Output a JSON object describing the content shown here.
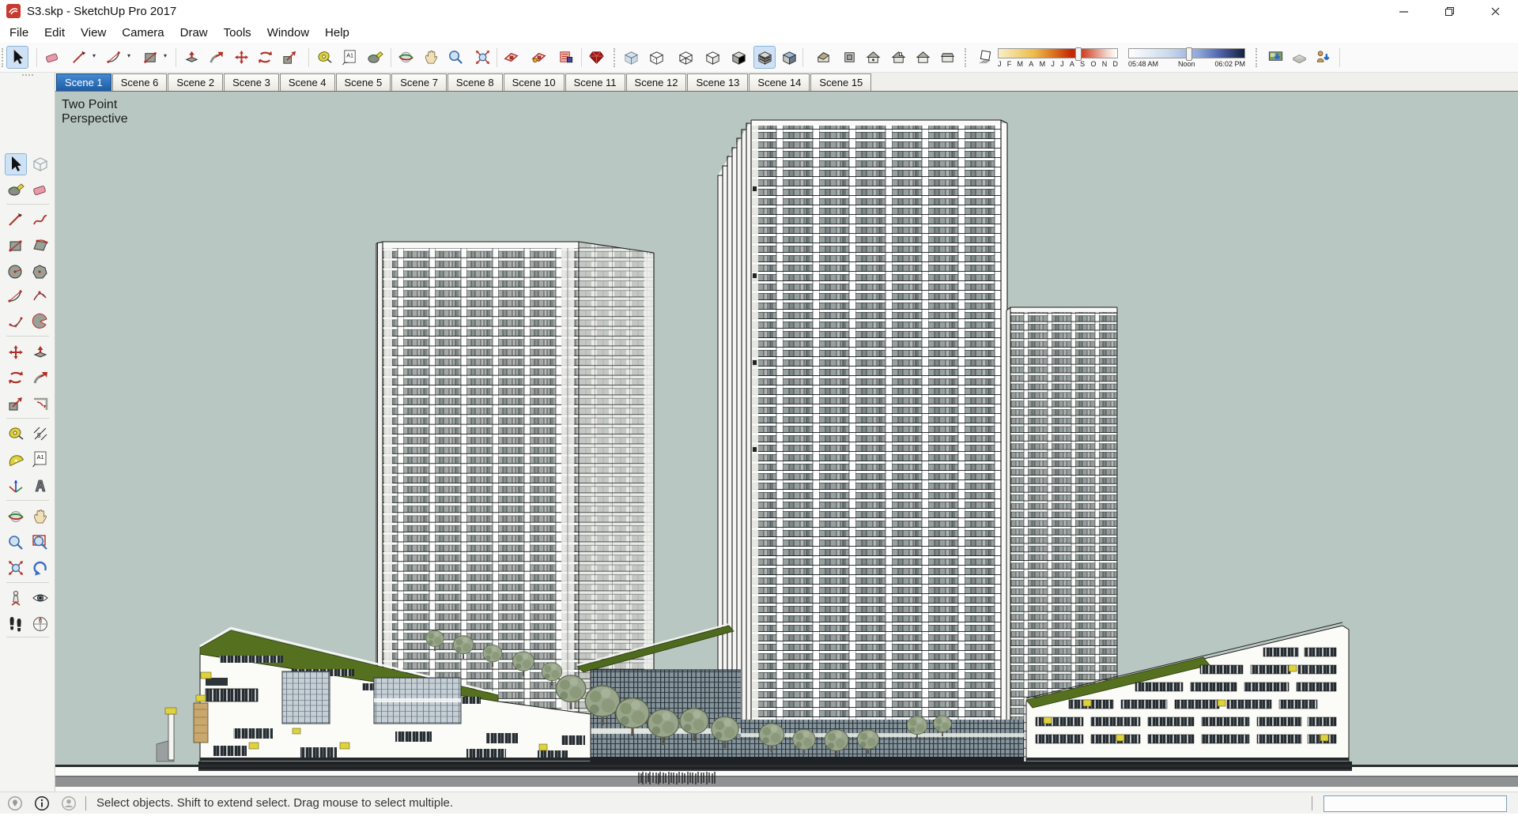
{
  "window": {
    "title": "S3.skp - SketchUp Pro 2017",
    "controls": [
      "minimize",
      "restore",
      "close"
    ]
  },
  "menu": {
    "items": [
      "File",
      "Edit",
      "View",
      "Camera",
      "Draw",
      "Tools",
      "Window",
      "Help"
    ]
  },
  "toolbar": {
    "items": [
      {
        "kind": "grip"
      },
      {
        "kind": "icon",
        "name": "select-icon",
        "active": true
      },
      {
        "kind": "sep"
      },
      {
        "kind": "icon",
        "name": "eraser-icon"
      },
      {
        "kind": "icon",
        "name": "line-icon"
      },
      {
        "kind": "dropdown"
      },
      {
        "kind": "icon",
        "name": "arc-icon"
      },
      {
        "kind": "dropdown"
      },
      {
        "kind": "icon",
        "name": "rectangle-icon"
      },
      {
        "kind": "dropdown"
      },
      {
        "kind": "sep"
      },
      {
        "kind": "icon",
        "name": "push-pull-icon"
      },
      {
        "kind": "icon",
        "name": "follow-me-icon"
      },
      {
        "kind": "icon",
        "name": "move-icon"
      },
      {
        "kind": "icon",
        "name": "rotate-icon"
      },
      {
        "kind": "icon",
        "name": "scale-icon"
      },
      {
        "kind": "sep"
      },
      {
        "kind": "icon",
        "name": "tape-measure-icon"
      },
      {
        "kind": "icon",
        "name": "text-icon"
      },
      {
        "kind": "icon",
        "name": "paint-bucket-icon"
      },
      {
        "kind": "sep"
      },
      {
        "kind": "icon",
        "name": "orbit-icon"
      },
      {
        "kind": "icon",
        "name": "pan-icon"
      },
      {
        "kind": "icon",
        "name": "zoom-icon"
      },
      {
        "kind": "icon",
        "name": "zoom-extents-icon"
      },
      {
        "kind": "sep"
      },
      {
        "kind": "icon",
        "name": "section-cut-icon"
      },
      {
        "kind": "icon",
        "name": "section-display-icon"
      },
      {
        "kind": "icon",
        "name": "section-fill-icon"
      },
      {
        "kind": "sep"
      },
      {
        "kind": "icon",
        "name": "ruby-console-icon"
      },
      {
        "kind": "grip"
      },
      {
        "kind": "icon",
        "name": "xray-icon"
      },
      {
        "kind": "icon",
        "name": "back-edges-icon"
      },
      {
        "kind": "icon",
        "name": "wireframe-icon"
      },
      {
        "kind": "icon",
        "name": "hidden-line-icon"
      },
      {
        "kind": "icon",
        "name": "shaded-icon"
      },
      {
        "kind": "icon",
        "name": "shaded-textures-icon",
        "active": true
      },
      {
        "kind": "icon",
        "name": "monochrome-icon"
      },
      {
        "kind": "sep"
      },
      {
        "kind": "icon",
        "name": "iso-view-icon"
      },
      {
        "kind": "icon",
        "name": "top-view-icon"
      },
      {
        "kind": "icon",
        "name": "front-view-icon"
      },
      {
        "kind": "icon",
        "name": "right-view-icon"
      },
      {
        "kind": "icon",
        "name": "back-view-icon"
      },
      {
        "kind": "icon",
        "name": "left-view-icon"
      },
      {
        "kind": "grip"
      },
      {
        "kind": "icon",
        "name": "shadows-toggle-icon"
      },
      {
        "kind": "date-slider"
      },
      {
        "kind": "time-slider"
      },
      {
        "kind": "grip"
      },
      {
        "kind": "icon",
        "name": "get-models-icon"
      },
      {
        "kind": "icon",
        "name": "share-model-icon"
      },
      {
        "kind": "icon",
        "name": "share-component-icon"
      },
      {
        "kind": "sep"
      }
    ],
    "date_slider": {
      "month_labels": [
        "J",
        "F",
        "M",
        "A",
        "M",
        "J",
        "J",
        "A",
        "S",
        "O",
        "N",
        "D"
      ],
      "handle_pos": 0.67
    },
    "time_slider": {
      "labels": [
        "05:48 AM",
        "Noon",
        "06:02 PM"
      ],
      "handle_pos": 0.52
    }
  },
  "scene_tabs": {
    "active": "Scene 1",
    "tabs": [
      "Scene 1",
      "Scene 6",
      "Scene 2",
      "Scene 3",
      "Scene 4",
      "Scene 5",
      "Scene 7",
      "Scene 8",
      "Scene 10",
      "Scene 11",
      "Scene 12",
      "Scene 13",
      "Scene 14",
      "Scene 15"
    ]
  },
  "left_toolbar": {
    "active": "select-icon",
    "rows": [
      [
        "select-icon",
        "make-component-icon"
      ],
      [
        "paint-bucket-icon",
        "eraser-icon"
      ],
      [
        "line-icon",
        "freehand-icon"
      ],
      [
        "rectangle-icon",
        "rotated-rectangle-icon"
      ],
      [
        "circle-icon",
        "polygon-icon"
      ],
      [
        "arc-icon",
        "two-point-arc-icon"
      ],
      [
        "three-point-arc-icon",
        "pie-icon"
      ],
      [
        "move-icon",
        "push-pull-icon"
      ],
      [
        "rotate-icon",
        "follow-me-icon"
      ],
      [
        "scale-icon",
        "offset-icon"
      ],
      [
        "tape-measure-icon",
        "dimension-icon"
      ],
      [
        "protractor-icon",
        "text-icon"
      ],
      [
        "axes-icon",
        "3d-text-icon"
      ],
      [
        "orbit-icon",
        "pan-icon"
      ],
      [
        "zoom-icon",
        "zoom-window-icon"
      ],
      [
        "zoom-extents-icon",
        "previous-icon"
      ],
      [
        "position-camera-icon",
        "look-around-icon"
      ],
      [
        "walk-icon",
        "section-plane-icon"
      ]
    ]
  },
  "viewport": {
    "camera_label_lines": [
      "Two Point",
      "Perspective"
    ],
    "background": "#b9c7c2"
  },
  "statusbar": {
    "icons": [
      "geolocation-icon",
      "info-icon",
      "user-icon"
    ],
    "message": "Select objects. Shift to extend select. Drag mouse to select multiple.",
    "measurements_value": ""
  },
  "colors": {
    "active_tab_blue": "#2f6fb4",
    "tool_highlight": "#cfe2f5",
    "viewport_background": "#b9c7c2",
    "roof_green": "#55701f",
    "accent_yellow": "#ded23d",
    "tool_red": "#b03028"
  }
}
